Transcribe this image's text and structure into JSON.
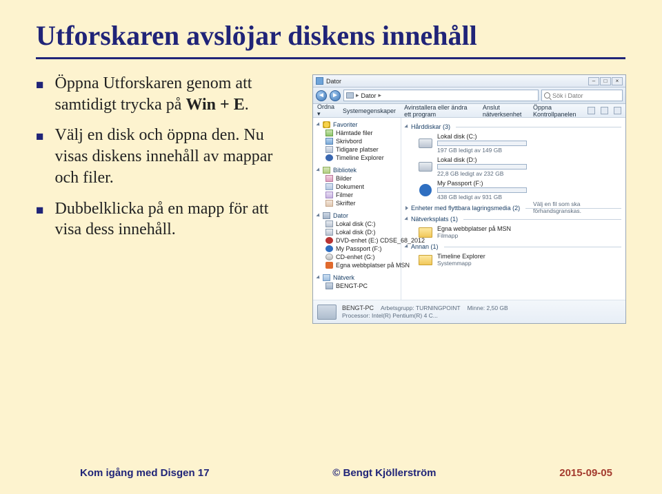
{
  "title": "Utforskaren avslöjar diskens innehåll",
  "bullets": [
    {
      "pre": "Öppna Utforskaren genom att samtidigt trycka på ",
      "bold": "Win + E",
      "post": "."
    },
    {
      "pre": "Välj en disk och öppna den. Nu visas diskens innehåll av mappar och filer.",
      "bold": "",
      "post": ""
    },
    {
      "pre": "Dubbelklicka på en mapp för att visa dess innehåll.",
      "bold": "",
      "post": ""
    }
  ],
  "footer": {
    "left": "Kom igång med Disgen 17",
    "mid": "© Bengt Kjöllerström",
    "right": "2015-09-05"
  },
  "explorer": {
    "window_title": "Dator",
    "breadcrumb": {
      "label": "Dator",
      "sep": "▸"
    },
    "search_placeholder": "Sök i Dator",
    "menu": {
      "organize": "Ordna ▾",
      "sysprops": "Systemegenskaper",
      "uninstall": "Avinstallera eller ändra ett program",
      "mapnet": "Anslut nätverksenhet",
      "ctrlpanel": "Öppna Kontrollpanelen"
    },
    "nav": {
      "fav_hdr": "Favoriter",
      "fav": [
        "Hämtade filer",
        "Skrivbord",
        "Tidigare platser",
        "Timeline Explorer"
      ],
      "lib_hdr": "Bibliotek",
      "lib": [
        "Bilder",
        "Dokument",
        "Filmer",
        "Skrifter"
      ],
      "pc_hdr": "Dator",
      "pc": [
        "Lokal disk (C:)",
        "Lokal disk (D:)",
        "DVD-enhet (E:) CDSE_68_2012",
        "My Passport (F:)",
        "CD-enhet (G:)",
        "Egna webbplatser på MSN"
      ],
      "net_hdr": "Nätverk",
      "net": [
        "BENGT-PC"
      ]
    },
    "groups": {
      "g1": "Hårddiskar (3)",
      "g2": "Enheter med flyttbara lagringsmedia (2)",
      "g3": "Nätverksplats (1)",
      "g4": "Annan (1)"
    },
    "drives": {
      "c_name": "Lokal disk (C:)",
      "c_sub": "197 GB ledigt av 149 GB",
      "d_name": "Lokal disk (D:)",
      "d_sub": "22,8 GB ledigt av 232 GB",
      "f_name": "My Passport (F:)",
      "f_sub": "438 GB ledigt av 931 GB",
      "msn_name": "Egna webbplatser på MSN",
      "msn_sub": "Filmapp",
      "te_name": "Timeline Explorer",
      "te_sub": "Systemmapp"
    },
    "hint": "Välj en fil som ska förhandsgranskas.",
    "details": {
      "name": "BENGT-PC",
      "wg_label": "Arbetsgrupp:",
      "wg": "TURNINGPOINT",
      "mem_label": "Minne:",
      "mem": "2,50 GB",
      "proc_label": "Processor:",
      "proc": "Intel(R) Pentium(R) 4 C..."
    }
  }
}
